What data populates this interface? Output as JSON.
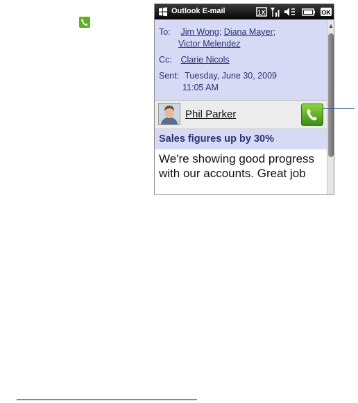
{
  "small_call_icon": "phone-call-icon",
  "window": {
    "title": "Outlook E-mail",
    "status_icons": [
      "windows-start-icon",
      "1x-network-icon",
      "signal-strength-icon",
      "speaker-mute-icon",
      "battery-icon",
      "ok-button"
    ],
    "ok_label": "OK",
    "network_label": "1X"
  },
  "email": {
    "to_label": "To:",
    "to_recipients": [
      "Jim Wong",
      "Diana Mayer",
      "Victor Melendez"
    ],
    "to_separator": ";",
    "cc_label": "Cc:",
    "cc_recipient": "Clarie Nicols",
    "sent_label": "Sent:",
    "sent_date": "Tuesday, June 30, 2009",
    "sent_time": "11:05 AM",
    "sender_name": "Phil Parker",
    "subject": "Sales figures up by 30%",
    "body": "We're showing good progress with our accounts. Great job"
  },
  "colors": {
    "header_bg": "#d6daf4",
    "text_blue": "#2b3175",
    "call_green": "#5fae26"
  }
}
